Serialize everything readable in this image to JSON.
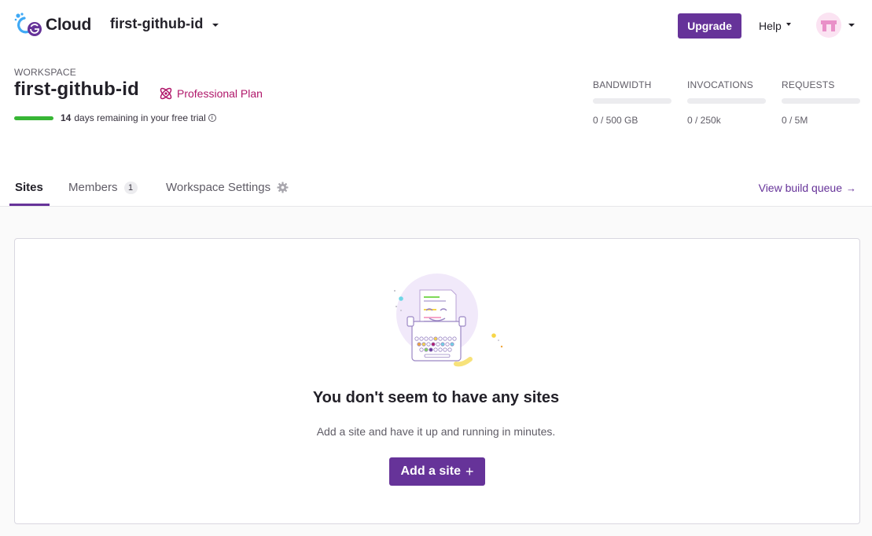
{
  "header": {
    "logo_text": "Cloud",
    "workspace_name": "first-github-id",
    "upgrade_label": "Upgrade",
    "help_label": "Help"
  },
  "workspace": {
    "label": "WORKSPACE",
    "title": "first-github-id",
    "plan_label": "Professional Plan",
    "trial_days": "14",
    "trial_text": "days remaining in your free trial",
    "trial_progress_fraction": 1.0
  },
  "metrics": [
    {
      "label": "BANDWIDTH",
      "value": "0 / 500 GB",
      "usage_fraction": 0
    },
    {
      "label": "INVOCATIONS",
      "value": "0 / 250k",
      "usage_fraction": 0
    },
    {
      "label": "REQUESTS",
      "value": "0 / 5M",
      "usage_fraction": 0
    }
  ],
  "tabs": [
    {
      "label": "Sites",
      "active": true
    },
    {
      "label": "Members",
      "badge": "1",
      "active": false
    },
    {
      "label": "Workspace Settings",
      "active": false
    }
  ],
  "build_queue_label": "View build queue",
  "empty_state": {
    "title": "You don't seem to have any sites",
    "description": "Add a site and have it up and running in minutes.",
    "add_button_label": "Add a site"
  },
  "colors": {
    "primary": "#663399",
    "plan": "#b0176a",
    "progress": "#37b635"
  },
  "icons": {
    "logo": "gatsby-cloud-logo-icon",
    "plan": "atom-icon",
    "info": "info-icon",
    "settings": "gear-icon",
    "arrow": "arrow-right-icon",
    "plus": "plus-icon",
    "caret": "chevron-down-icon"
  }
}
